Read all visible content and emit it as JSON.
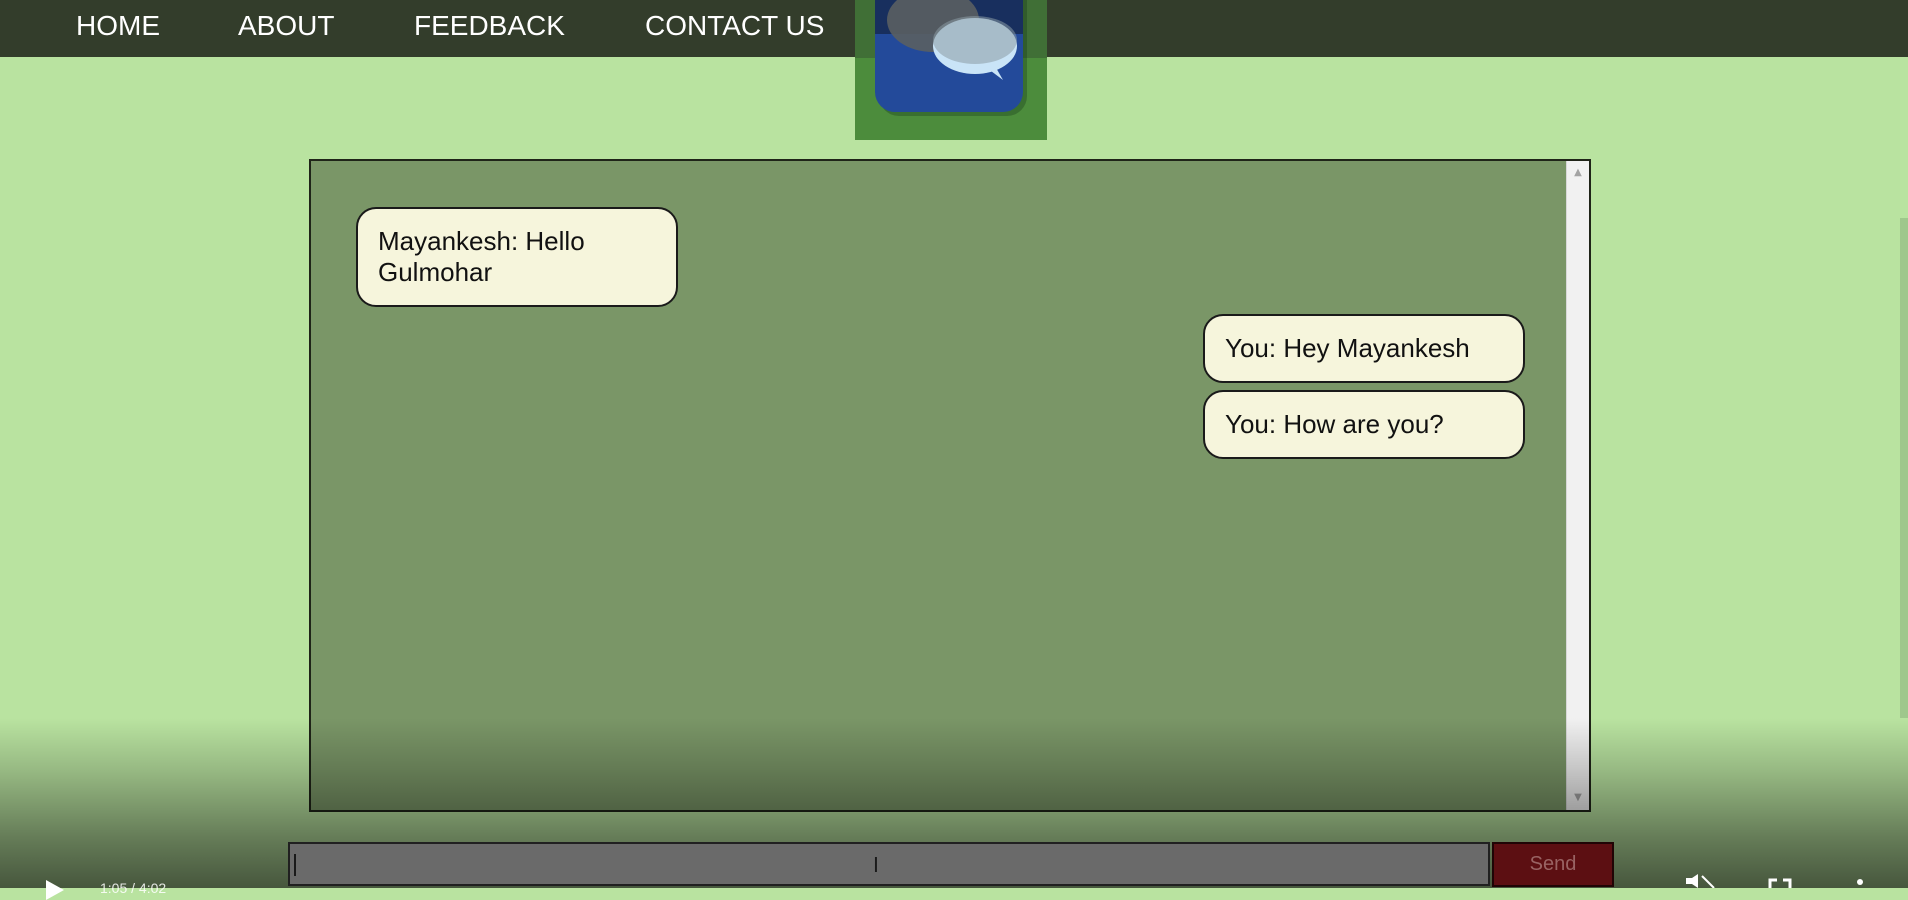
{
  "nav": {
    "items": [
      {
        "label": "HOME"
      },
      {
        "label": "ABOUT"
      },
      {
        "label": "FEEDBACK"
      },
      {
        "label": "CONTACT US"
      }
    ]
  },
  "logo": {
    "icon": "chat-bubbles-icon"
  },
  "chat": {
    "messages": [
      {
        "sender": "Mayankesh",
        "side": "left",
        "text": "Mayankesh: Hello Gulmohar"
      },
      {
        "sender": "You",
        "side": "right",
        "text": "You: Hey Mayankesh"
      },
      {
        "sender": "You",
        "side": "right",
        "text": "You: How are you?"
      }
    ]
  },
  "composer": {
    "input_value": "",
    "send_label": "Send"
  },
  "player": {
    "time": "1:05 / 4:02",
    "icons": [
      "play-icon",
      "mute-icon",
      "fullscreen-icon",
      "more-options-icon"
    ]
  },
  "colors": {
    "page_background": "#b9e3a0",
    "navbar": "#333d2b",
    "logo_background": "#4c8c3c",
    "chat_panel": "#7a9667",
    "bubble": "#f6f5dc",
    "send_button": "#5c0f12"
  }
}
